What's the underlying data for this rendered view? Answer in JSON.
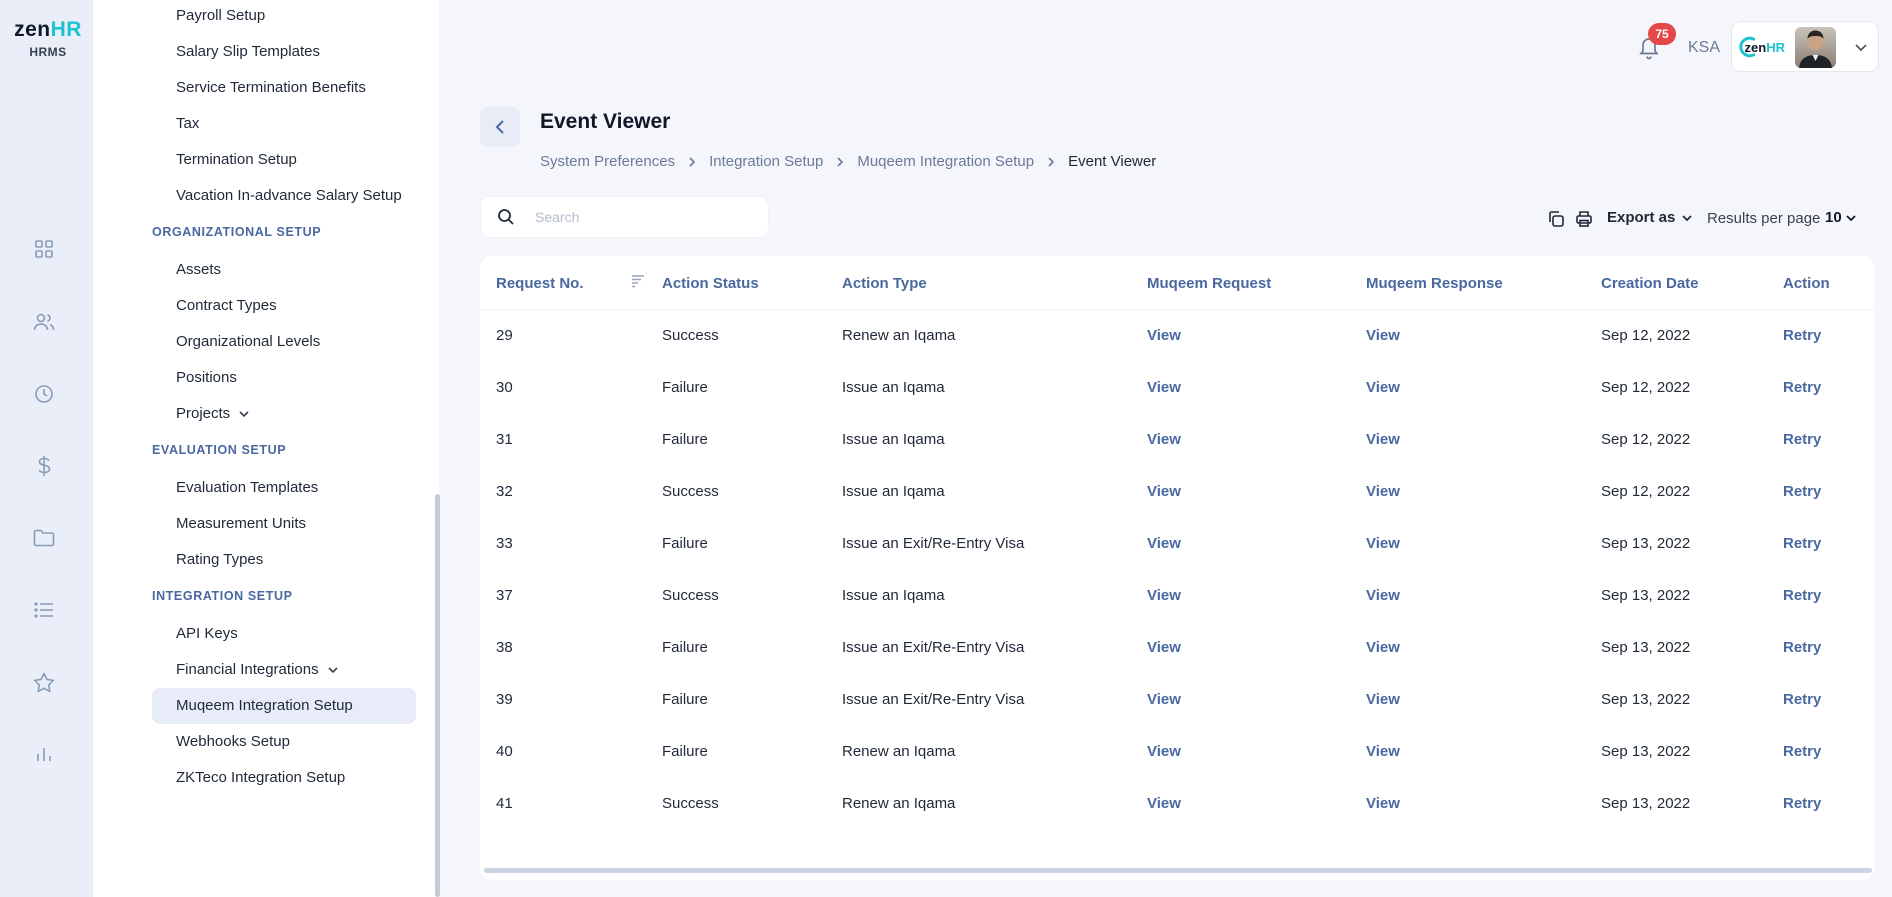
{
  "brand": {
    "logo_main": "zen",
    "logo_accent": "HR",
    "logo_sub": "HRMS"
  },
  "rail": [
    "dashboard-icon",
    "people-icon",
    "clock-icon",
    "dollar-icon",
    "folder-icon",
    "list-icon",
    "star-icon",
    "chart-icon"
  ],
  "menu": {
    "top_items": [
      "Payroll Setup",
      "Salary Slip Templates",
      "Service Termination Benefits",
      "Tax",
      "Termination Setup",
      "Vacation In-advance Salary Setup"
    ],
    "organizational": {
      "title": "ORGANIZATIONAL SETUP",
      "items": [
        "Assets",
        "Contract Types",
        "Organizational Levels",
        "Positions",
        "Projects"
      ]
    },
    "evaluation": {
      "title": "EVALUATION SETUP",
      "items": [
        "Evaluation Templates",
        "Measurement Units",
        "Rating Types"
      ]
    },
    "integration": {
      "title": "INTEGRATION SETUP",
      "items": [
        "API Keys",
        "Financial Integrations",
        "Muqeem Integration Setup",
        "Webhooks Setup",
        "ZKTeco Integration Setup"
      ],
      "active": "Muqeem Integration Setup"
    }
  },
  "header": {
    "notifications_count": "75",
    "region": "KSA",
    "company_logo_main": "zen",
    "company_logo_accent": "HR"
  },
  "page": {
    "title": "Event Viewer",
    "breadcrumb": [
      "System Preferences",
      "Integration Setup",
      "Muqeem Integration Setup",
      "Event Viewer"
    ]
  },
  "toolbar": {
    "search_placeholder": "Search",
    "export_label": "Export as",
    "results_label": "Results per page",
    "results_value": "10"
  },
  "table": {
    "columns": [
      "Request No.",
      "Action Status",
      "Action Type",
      "Muqeem Request",
      "Muqeem Response",
      "Creation Date",
      "Action"
    ],
    "rows": [
      {
        "no": "29",
        "status": "Success",
        "type": "Renew an Iqama",
        "request": "View",
        "response": "View",
        "date": "Sep 12, 2022",
        "action": "Retry"
      },
      {
        "no": "30",
        "status": "Failure",
        "type": "Issue an Iqama",
        "request": "View",
        "response": "View",
        "date": "Sep 12, 2022",
        "action": "Retry"
      },
      {
        "no": "31",
        "status": "Failure",
        "type": "Issue an Iqama",
        "request": "View",
        "response": "View",
        "date": "Sep 12, 2022",
        "action": "Retry"
      },
      {
        "no": "32",
        "status": "Success",
        "type": "Issue an Iqama",
        "request": "View",
        "response": "View",
        "date": "Sep 12, 2022",
        "action": "Retry"
      },
      {
        "no": "33",
        "status": "Failure",
        "type": "Issue an Exit/Re-Entry Visa",
        "request": "View",
        "response": "View",
        "date": "Sep 13, 2022",
        "action": "Retry"
      },
      {
        "no": "37",
        "status": "Success",
        "type": "Issue an Iqama",
        "request": "View",
        "response": "View",
        "date": "Sep 13, 2022",
        "action": "Retry"
      },
      {
        "no": "38",
        "status": "Failure",
        "type": "Issue an Exit/Re-Entry Visa",
        "request": "View",
        "response": "View",
        "date": "Sep 13, 2022",
        "action": "Retry"
      },
      {
        "no": "39",
        "status": "Failure",
        "type": "Issue an Exit/Re-Entry Visa",
        "request": "View",
        "response": "View",
        "date": "Sep 13, 2022",
        "action": "Retry"
      },
      {
        "no": "40",
        "status": "Failure",
        "type": "Renew an Iqama",
        "request": "View",
        "response": "View",
        "date": "Sep 13, 2022",
        "action": "Retry"
      },
      {
        "no": "41",
        "status": "Success",
        "type": "Renew an Iqama",
        "request": "View",
        "response": "View",
        "date": "Sep 13, 2022",
        "action": "Retry"
      }
    ]
  },
  "colors": {
    "accent": "#4a68a0",
    "brand_teal": "#19c3cf",
    "badge": "#e54848",
    "active_bg": "#e8ecf9"
  }
}
